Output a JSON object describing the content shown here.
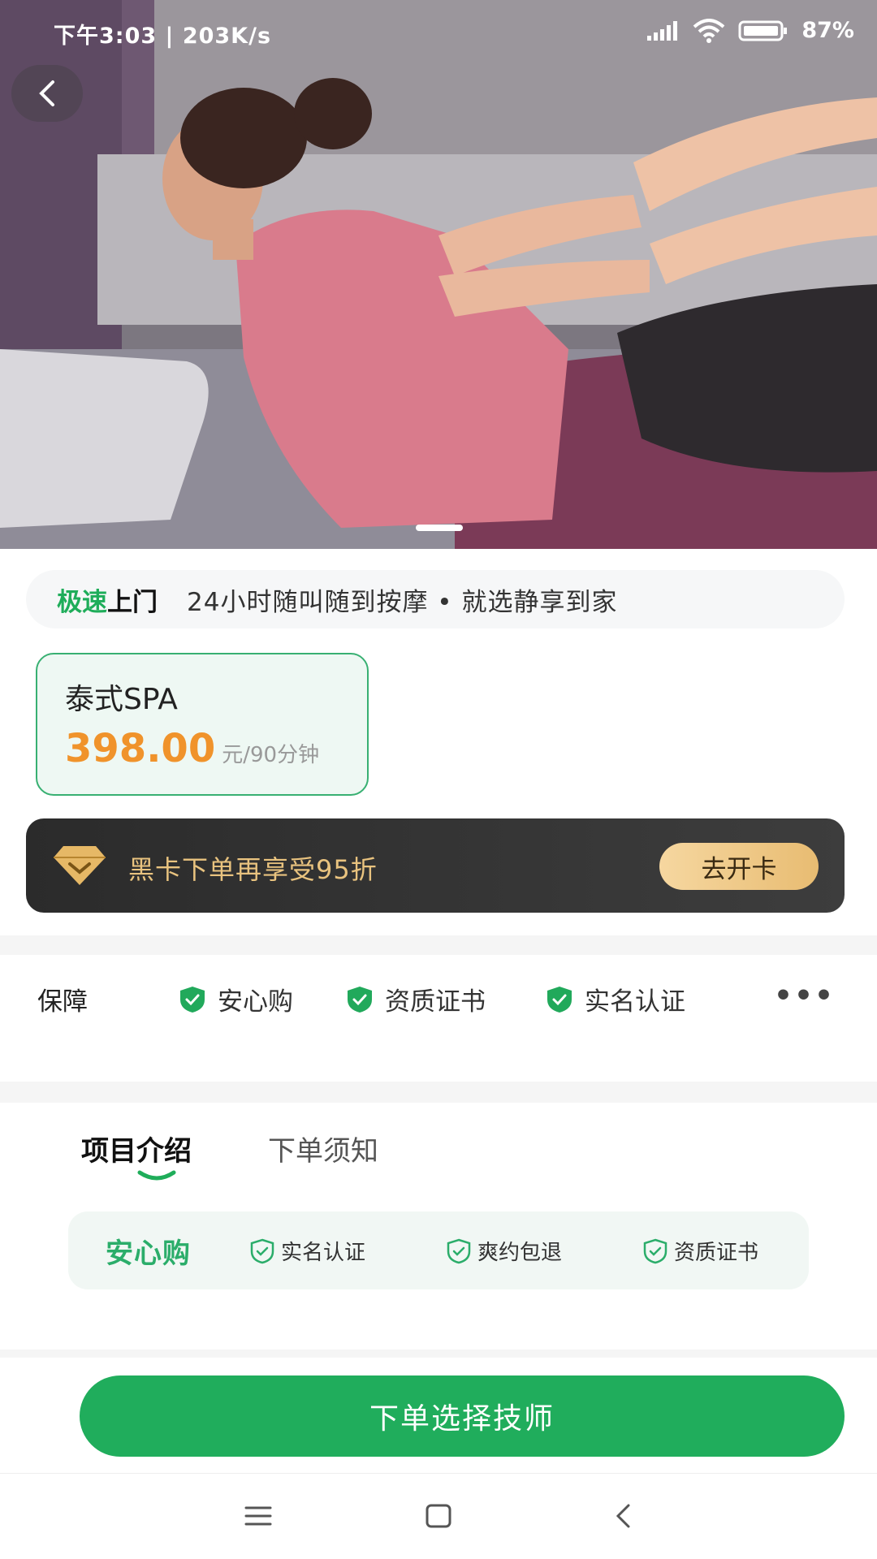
{
  "status_bar": {
    "left_text": "下午3:03 | 203K/s",
    "battery": "87%"
  },
  "hero": {
    "image_subject": "thai-massage-photo",
    "page_index": 1
  },
  "slogan": {
    "highlight_green": "极速",
    "highlight_dark": "上门",
    "description": "24小时随叫随到按摩 • 就选静享到家"
  },
  "service": {
    "name": "泰式SPA",
    "price": "398.00",
    "unit": "元/90分钟"
  },
  "vip": {
    "text": "黑卡下单再享受95折",
    "button": "去开卡"
  },
  "guarantee": {
    "title": "保障",
    "items": [
      "安心购",
      "资质证书",
      "实名认证"
    ]
  },
  "tabs": {
    "items": [
      "项目介绍",
      "下单须知"
    ],
    "active": 0
  },
  "assurance": {
    "title": "安心购",
    "items": [
      "实名认证",
      "爽约包退",
      "资质证书"
    ]
  },
  "cta": {
    "label": "下单选择技师"
  },
  "colors": {
    "brand_green": "#20ad5c",
    "price_orange": "#f0932b",
    "vip_gold": "#e9c37f"
  }
}
